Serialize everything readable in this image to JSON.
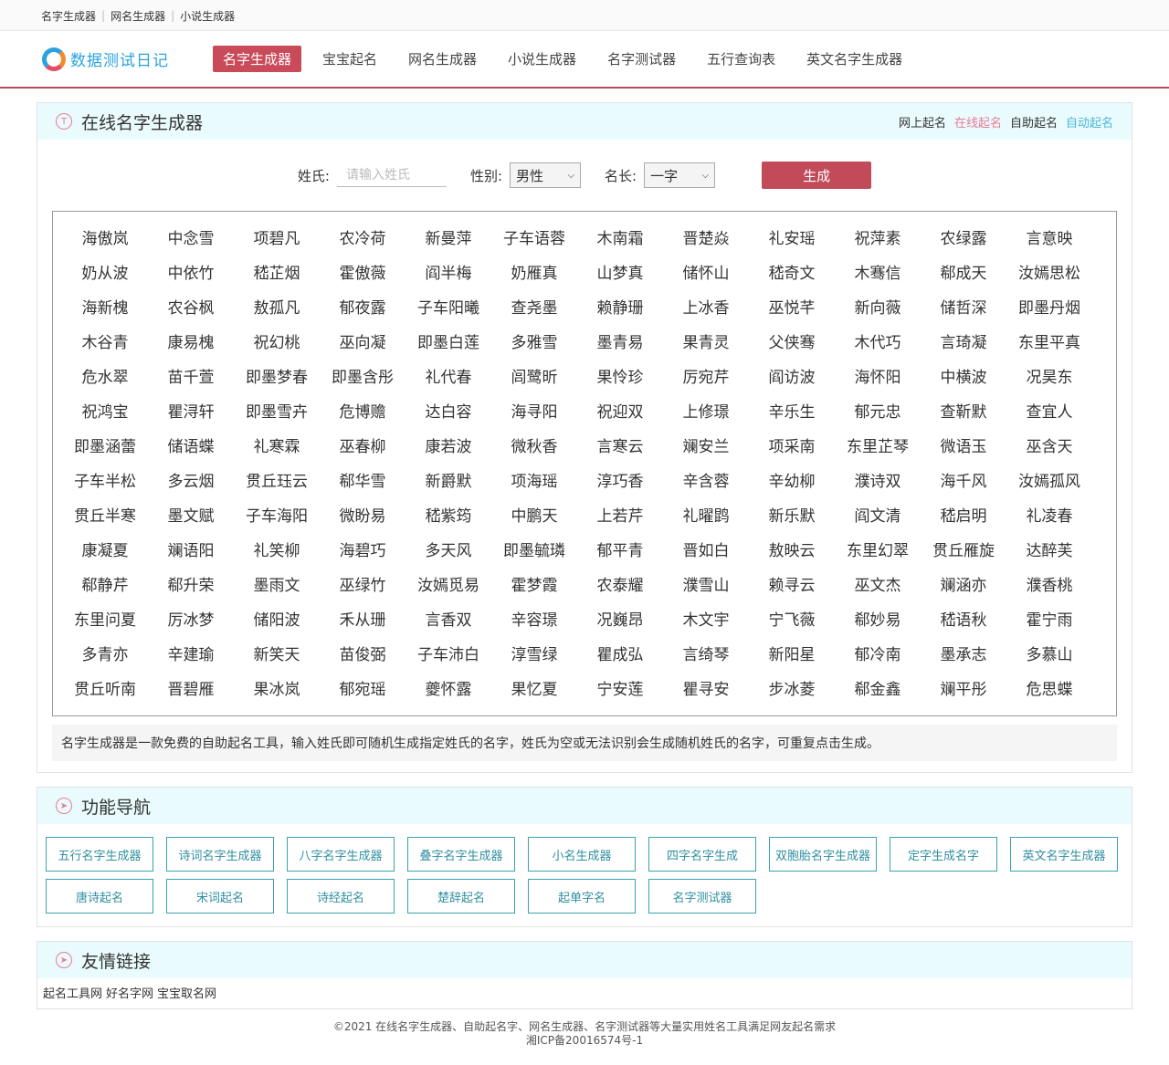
{
  "topbar": {
    "links": [
      "名字生成器",
      "网名生成器",
      "小说生成器"
    ]
  },
  "logo": {
    "text": "数据测试日记"
  },
  "nav": [
    {
      "label": "名字生成器",
      "active": true
    },
    {
      "label": "宝宝起名"
    },
    {
      "label": "网名生成器"
    },
    {
      "label": "小说生成器"
    },
    {
      "label": "名字测试器"
    },
    {
      "label": "五行查询表"
    },
    {
      "label": "英文名字生成器"
    }
  ],
  "generator": {
    "icon_letter": "T",
    "title": "在线名字生成器",
    "header_links": [
      {
        "label": "网上起名",
        "color": "#333333"
      },
      {
        "label": "在线起名",
        "color": "#e87b94"
      },
      {
        "label": "自助起名",
        "color": "#333333"
      },
      {
        "label": "自动起名",
        "color": "#49b8d6"
      }
    ],
    "surname_label": "姓氏:",
    "surname_placeholder": "请输入姓氏",
    "gender_label": "性别:",
    "gender_value": "男性",
    "length_label": "名长:",
    "length_value": "一字",
    "generate_label": "生成",
    "names": [
      "海傲岚",
      "中念雪",
      "项碧凡",
      "农冷荷",
      "新曼萍",
      "子车语蓉",
      "木南霜",
      "晋楚焱",
      "礼安瑶",
      "祝萍素",
      "农绿露",
      "言意映",
      "奶从波",
      "中依竹",
      "嵇芷烟",
      "霍傲薇",
      "阎半梅",
      "奶雁真",
      "山梦真",
      "储怀山",
      "嵇奇文",
      "木骞信",
      "郗成天",
      "汝嫣思松",
      "海新槐",
      "农谷枫",
      "敖孤凡",
      "郁夜露",
      "子车阳曦",
      "查尧墨",
      "赖静珊",
      "上冰香",
      "巫悦芊",
      "新向薇",
      "储哲深",
      "即墨丹烟",
      "木谷青",
      "康易槐",
      "祝幻桃",
      "巫向凝",
      "即墨白莲",
      "多雅雪",
      "墨青易",
      "果青灵",
      "父侠骞",
      "木代巧",
      "言琦凝",
      "东里平真",
      "危水翠",
      "苗千萱",
      "即墨梦春",
      "即墨含彤",
      "礼代春",
      "闾鹭昕",
      "果怜珍",
      "厉宛芹",
      "阎访波",
      "海怀阳",
      "中横波",
      "况昊东",
      "祝鸿宝",
      "瞿浔轩",
      "即墨雪卉",
      "危博赡",
      "达白容",
      "海寻阳",
      "祝迎双",
      "上修璟",
      "辛乐生",
      "郁元忠",
      "查靳默",
      "查宜人",
      "即墨涵蕾",
      "储语蝶",
      "礼寒霖",
      "巫春柳",
      "康若波",
      "微秋香",
      "言寒云",
      "斓安兰",
      "项采南",
      "东里芷琴",
      "微语玉",
      "巫含天",
      "子车半松",
      "多云烟",
      "贯丘珏云",
      "郗华雪",
      "新爵默",
      "项海瑶",
      "淳巧香",
      "辛含蓉",
      "辛幼柳",
      "濮诗双",
      "海千风",
      "汝嫣孤风",
      "贯丘半寒",
      "墨文赋",
      "子车海阳",
      "微盼易",
      "嵇紫筠",
      "中鹏天",
      "上若芹",
      "礼曜鹍",
      "新乐默",
      "阎文清",
      "嵇启明",
      "礼凌春",
      "康凝夏",
      "斓语阳",
      "礼笑柳",
      "海碧巧",
      "多天风",
      "即墨毓璘",
      "郁平青",
      "晋如白",
      "敖映云",
      "东里幻翠",
      "贯丘雁旋",
      "达醉芙",
      "郗静芹",
      "郗升荣",
      "墨雨文",
      "巫绿竹",
      "汝嫣觅易",
      "霍梦霞",
      "农泰耀",
      "濮雪山",
      "赖寻云",
      "巫文杰",
      "斓涵亦",
      "濮香桃",
      "东里问夏",
      "厉冰梦",
      "储阳波",
      "禾从珊",
      "言香双",
      "辛容璟",
      "况巍昂",
      "木文宇",
      "宁飞薇",
      "郗妙易",
      "嵇语秋",
      "霍宁雨",
      "多青亦",
      "辛建瑜",
      "新笑天",
      "苗俊弼",
      "子车沛白",
      "淳雪绿",
      "瞿成弘",
      "言绮琴",
      "新阳星",
      "郁冷南",
      "墨承志",
      "多慕山",
      "贯丘听南",
      "晋碧雁",
      "果冰岚",
      "郁宛瑶",
      "夔怀露",
      "果忆夏",
      "宁安莲",
      "瞿寻安",
      "步冰菱",
      "郗金鑫",
      "斓平彤",
      "危思蝶"
    ],
    "description": "名字生成器是一款免费的自助起名工具，输入姓氏即可随机生成指定姓氏的名字，姓氏为空或无法识别会生成随机姓氏的名字，可重复点击生成。"
  },
  "features": {
    "title": "功能导航",
    "items": [
      "五行名字生成器",
      "诗词名字生成器",
      "八字名字生成器",
      "叠字名字生成器",
      "小名生成器",
      "四字名字生成",
      "双胞胎名字生成器",
      "定字生成名字",
      "英文名字生成器",
      "唐诗起名",
      "宋词起名",
      "诗经起名",
      "楚辞起名",
      "起单字名",
      "名字测试器"
    ]
  },
  "friends": {
    "title": "友情链接",
    "items": [
      "起名工具网",
      "好名字网",
      "宝宝取名网"
    ]
  },
  "footer": {
    "line1": "©2021 在线名字生成器、自助起名字、网名生成器、名字测试器等大量实用姓名工具满足网友起名需求",
    "line2": "湘ICP备20016574号-1"
  }
}
